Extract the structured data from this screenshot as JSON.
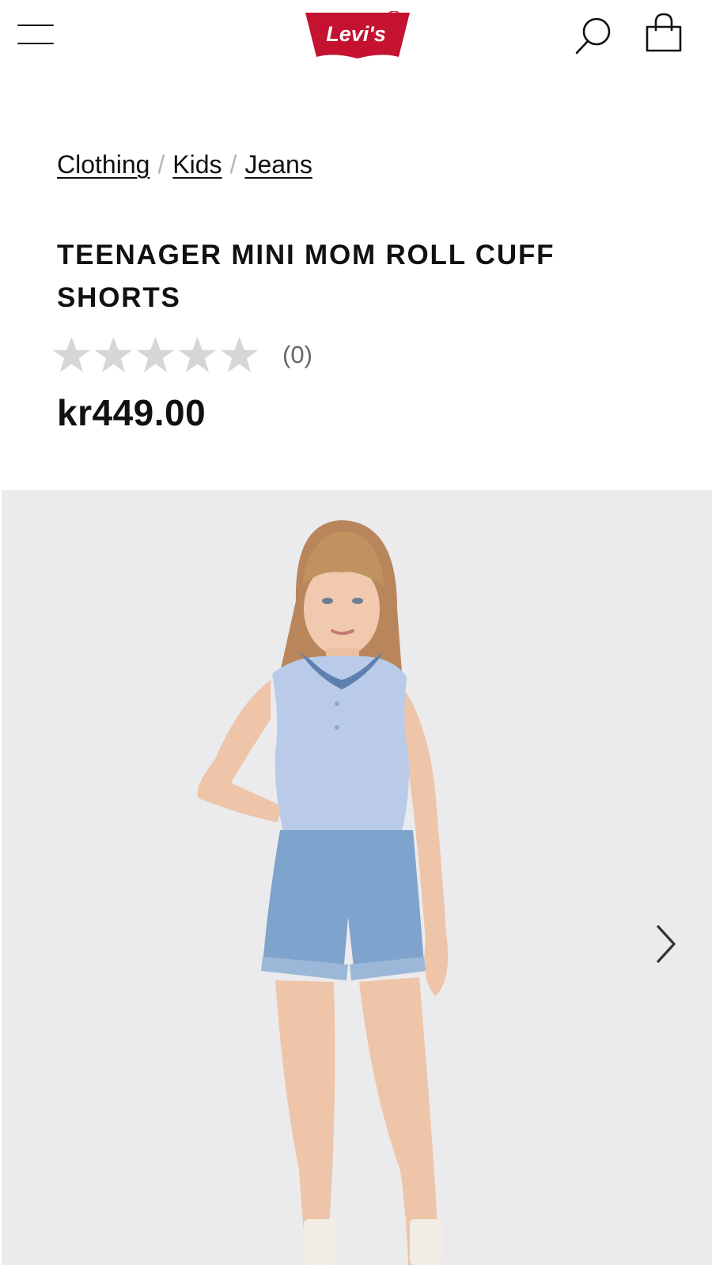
{
  "header": {
    "menu_icon": "hamburger-menu-icon",
    "logo_text": "Levi's",
    "logo_mark": "®",
    "search_icon": "search-icon",
    "bag_icon": "shopping-bag-icon"
  },
  "breadcrumb": {
    "items": [
      {
        "label": "Clothing"
      },
      {
        "label": "Kids"
      },
      {
        "label": "Jeans"
      }
    ],
    "separator": "/"
  },
  "product": {
    "title": "TEENAGER MINI MOM ROLL CUFF SHORTS",
    "rating": {
      "stars_filled": 0,
      "stars_total": 5,
      "count_text": "(0)"
    },
    "price": "kr449.00"
  },
  "gallery": {
    "next_icon": "chevron-right-icon"
  },
  "colors": {
    "brand_red": "#c41230",
    "star_empty": "#d6d6d6",
    "image_bg": "#ebeaec"
  }
}
